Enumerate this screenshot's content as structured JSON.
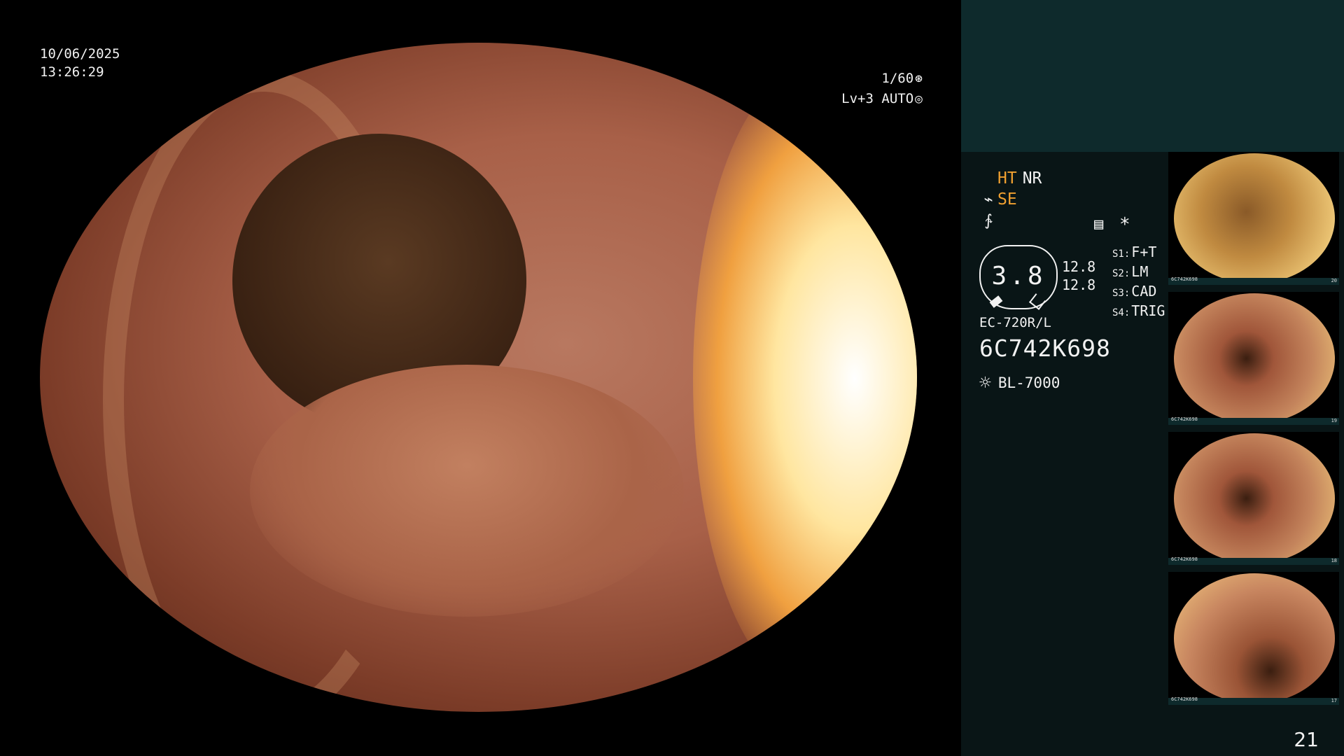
{
  "overlay": {
    "date": "10/06/2025",
    "time": "13:26:29",
    "shutter": "1/60",
    "shutter_icon": "aperture-icon",
    "level": "Lv+3",
    "iris": "AUTO",
    "iris_icon": "iris-icon"
  },
  "panel": {
    "modes": {
      "ht": "HT",
      "nr": "NR",
      "se": "SE"
    },
    "gauge": {
      "value": "3.8",
      "num_top": "12.8",
      "num_bottom": "12.8"
    },
    "switches": [
      {
        "label": "S1:",
        "value": "F+T"
      },
      {
        "label": "S2:",
        "value": "LM"
      },
      {
        "label": "S3:",
        "value": "CAD"
      },
      {
        "label": "S4:",
        "value": "TRIG"
      }
    ],
    "scope_model": "EC-720R/L",
    "scope_serial": "6C742K698",
    "light_source": "BL-7000"
  },
  "thumbnails": [
    {
      "code": "6C742K698",
      "index": "20"
    },
    {
      "code": "6C742K698",
      "index": "19"
    },
    {
      "code": "6C742K698",
      "index": "18"
    },
    {
      "code": "6C742K698",
      "index": "17"
    }
  ],
  "page_number": "21",
  "colors": {
    "panel_bg": "#091516",
    "panel_header": "#0e2a2c",
    "accent": "#f0a030"
  }
}
